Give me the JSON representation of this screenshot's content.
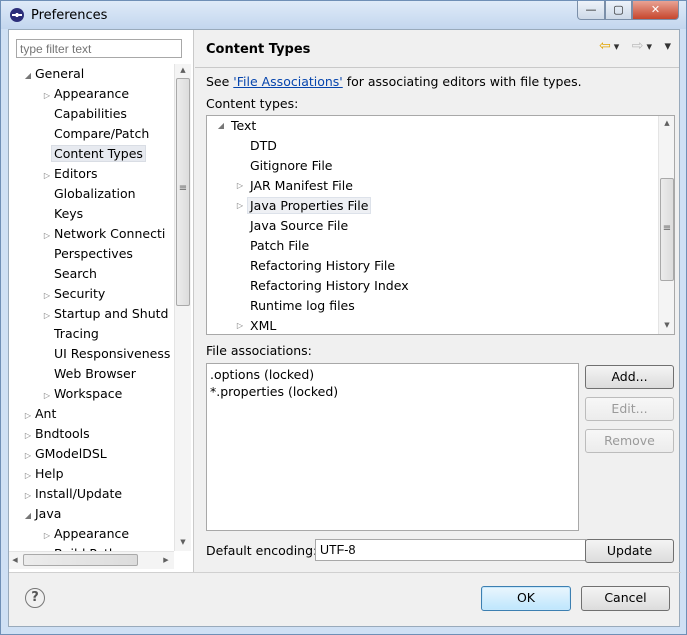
{
  "window": {
    "title": "Preferences",
    "min_glyph": "—",
    "max_glyph": "▢",
    "close_glyph": "✕"
  },
  "filter": {
    "placeholder": "type filter text"
  },
  "tree": [
    {
      "label": "General",
      "level": 0,
      "toggle": "◢"
    },
    {
      "label": "Appearance",
      "level": 1,
      "toggle": "▷"
    },
    {
      "label": "Capabilities",
      "level": 1,
      "toggle": ""
    },
    {
      "label": "Compare/Patch",
      "level": 1,
      "toggle": ""
    },
    {
      "label": "Content Types",
      "level": 1,
      "toggle": "",
      "selected": true
    },
    {
      "label": "Editors",
      "level": 1,
      "toggle": "▷"
    },
    {
      "label": "Globalization",
      "level": 1,
      "toggle": ""
    },
    {
      "label": "Keys",
      "level": 1,
      "toggle": ""
    },
    {
      "label": "Network Connecti",
      "level": 1,
      "toggle": "▷"
    },
    {
      "label": "Perspectives",
      "level": 1,
      "toggle": ""
    },
    {
      "label": "Search",
      "level": 1,
      "toggle": ""
    },
    {
      "label": "Security",
      "level": 1,
      "toggle": "▷"
    },
    {
      "label": "Startup and Shutd",
      "level": 1,
      "toggle": "▷"
    },
    {
      "label": "Tracing",
      "level": 1,
      "toggle": ""
    },
    {
      "label": "UI Responsiveness",
      "level": 1,
      "toggle": ""
    },
    {
      "label": "Web Browser",
      "level": 1,
      "toggle": ""
    },
    {
      "label": "Workspace",
      "level": 1,
      "toggle": "▷"
    },
    {
      "label": "Ant",
      "level": 0,
      "toggle": "▷"
    },
    {
      "label": "Bndtools",
      "level": 0,
      "toggle": "▷"
    },
    {
      "label": "GModelDSL",
      "level": 0,
      "toggle": "▷"
    },
    {
      "label": "Help",
      "level": 0,
      "toggle": "▷"
    },
    {
      "label": "Install/Update",
      "level": 0,
      "toggle": "▷"
    },
    {
      "label": "Java",
      "level": 0,
      "toggle": "◢"
    },
    {
      "label": "Appearance",
      "level": 1,
      "toggle": "▷"
    },
    {
      "label": "Build Path",
      "level": 1,
      "toggle": "▷"
    }
  ],
  "page": {
    "title": "Content Types",
    "desc_before": "See ",
    "desc_link": "'File Associations'",
    "desc_after": " for associating editors with file types.",
    "content_types_label": "Content types:",
    "file_assoc_label": "File associations:",
    "encoding_label": "Default encoding:",
    "encoding_value": "UTF-8"
  },
  "content_types": [
    {
      "label": "Text",
      "level": 0,
      "toggle": "◢"
    },
    {
      "label": "DTD",
      "level": 1,
      "toggle": ""
    },
    {
      "label": "Gitignore File",
      "level": 1,
      "toggle": ""
    },
    {
      "label": "JAR Manifest File",
      "level": 1,
      "toggle": "▷"
    },
    {
      "label": "Java Properties File",
      "level": 1,
      "toggle": "▷",
      "selected": true
    },
    {
      "label": "Java Source File",
      "level": 1,
      "toggle": ""
    },
    {
      "label": "Patch File",
      "level": 1,
      "toggle": ""
    },
    {
      "label": "Refactoring History File",
      "level": 1,
      "toggle": ""
    },
    {
      "label": "Refactoring History Index",
      "level": 1,
      "toggle": ""
    },
    {
      "label": "Runtime log files",
      "level": 1,
      "toggle": ""
    },
    {
      "label": "XML",
      "level": 1,
      "toggle": "▷"
    }
  ],
  "file_associations": [
    ".options (locked)",
    "*.properties (locked)"
  ],
  "buttons": {
    "add": "Add...",
    "edit": "Edit...",
    "remove": "Remove",
    "update": "Update",
    "ok": "OK",
    "cancel": "Cancel",
    "help": "?"
  },
  "icons": {
    "back": "⇦",
    "forward": "⇨",
    "dropdown": "▾",
    "menu": "▾",
    "scroll_up": "▲",
    "scroll_down": "▼",
    "scroll_left": "◀",
    "scroll_right": "▶",
    "grip": "≡"
  }
}
